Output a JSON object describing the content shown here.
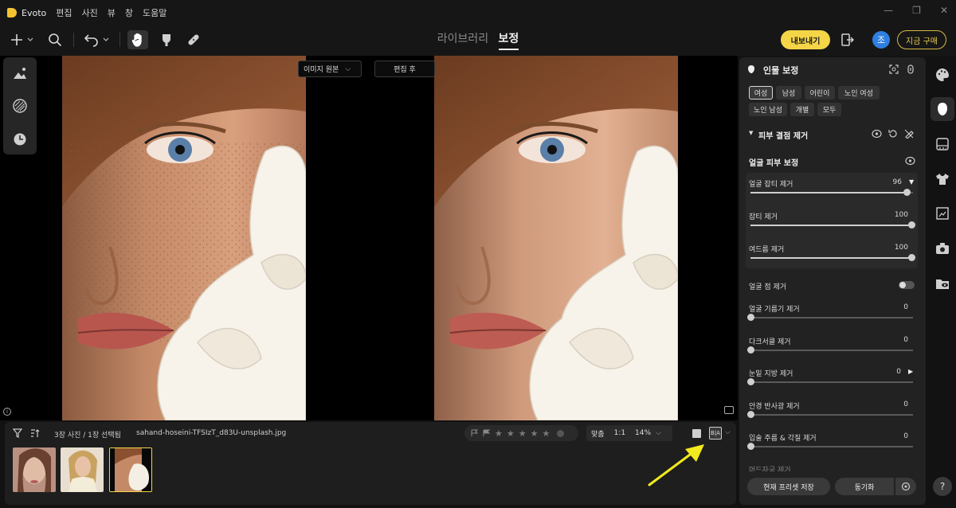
{
  "app": {
    "title": "Evoto"
  },
  "menu": [
    "편집",
    "사진",
    "뷰",
    "창",
    "도움말"
  ],
  "tabs": {
    "library": "라이브러리",
    "edit": "보정"
  },
  "header": {
    "export_label": "내보내기",
    "avatar_initial": "조",
    "buy_label": "지금 구매"
  },
  "canvas": {
    "view_select": "이미지 원본",
    "after_label": "편집 후"
  },
  "filmstrip": {
    "count_text": "3장 사진 / 1장 선택됨",
    "filename": "sahand-hoseini-TFSIzT_d83U-unsplash.jpg",
    "fit_label": "맞춤",
    "one_to_one": "1:1",
    "zoom": "14%",
    "ba_label": "B|A",
    "thumbnails": [
      "thumb-1",
      "thumb-2",
      "thumb-3"
    ],
    "selected_thumb": 3
  },
  "panel": {
    "title": "인물 보정",
    "chips": [
      "여성",
      "남성",
      "어린이",
      "노인 여성",
      "노인 남성",
      "개별",
      "모두"
    ],
    "active_chip": "여성",
    "section_title": "피부 결점 제거",
    "subsection_title": "얼굴 피부 보정",
    "sliders": [
      {
        "label": "얼굴 잡티 제거",
        "value": 96,
        "max": 100
      },
      {
        "label": "잡티 제거",
        "value": 100,
        "max": 100
      },
      {
        "label": "여드름 제거",
        "value": 100,
        "max": 100
      }
    ],
    "toggle_label": "얼굴 점 제거",
    "toggle_on": false,
    "more_sliders": [
      {
        "label": "얼굴 기름기 제거",
        "value": 0,
        "max": 100
      },
      {
        "label": "다크서클 제거",
        "value": 0,
        "max": 100
      },
      {
        "label": "눈밑 지방 제거",
        "value": 0,
        "max": 100
      },
      {
        "label": "안경 반사광 제거",
        "value": 0,
        "max": 100
      },
      {
        "label": "입술 주름 & 각질 제거",
        "value": 0,
        "max": 100
      }
    ],
    "cut_label": "머드자국 제거",
    "save_preset": "현재 프리셋 저장",
    "sync": "동기화"
  },
  "colors": {
    "accent": "#f5d547",
    "avatar": "#2f7fe0",
    "arrow": "#f2ea1d"
  }
}
